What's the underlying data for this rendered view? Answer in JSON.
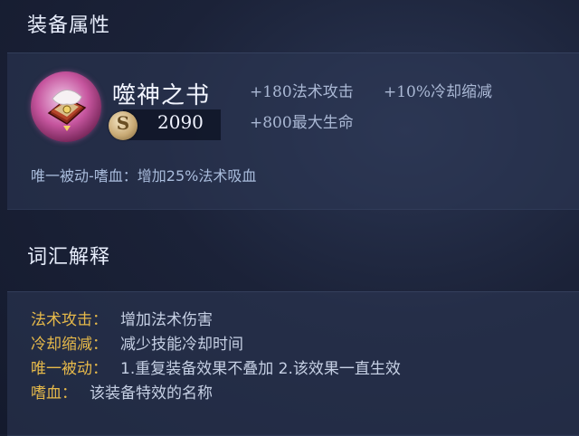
{
  "sections": {
    "attributes_title": "装备属性",
    "glossary_title": "词汇解释"
  },
  "item": {
    "name": "噬神之书",
    "price": "2090",
    "coin_symbol": "S",
    "stats": [
      "+180法术攻击",
      "+10%冷却缩减",
      "+800最大生命"
    ],
    "passive": "唯一被动-嗜血：增加25%法术吸血"
  },
  "glossary": [
    {
      "term": "法术攻击",
      "desc": "增加法术伤害"
    },
    {
      "term": "冷却缩减",
      "desc": "减少技能冷却时间"
    },
    {
      "term": "唯一被动",
      "desc": "1.重复装备效果不叠加 2.该效果一直生效"
    },
    {
      "term": "嗜血",
      "desc": "该装备特效的名称"
    }
  ],
  "colors": {
    "term_color": "#e6b94a",
    "background": "#1b2238",
    "icon_rim": "#c6559e"
  },
  "icons": {
    "item_icon": "book-of-gods-icon",
    "currency_icon": "gold-coin-icon"
  }
}
